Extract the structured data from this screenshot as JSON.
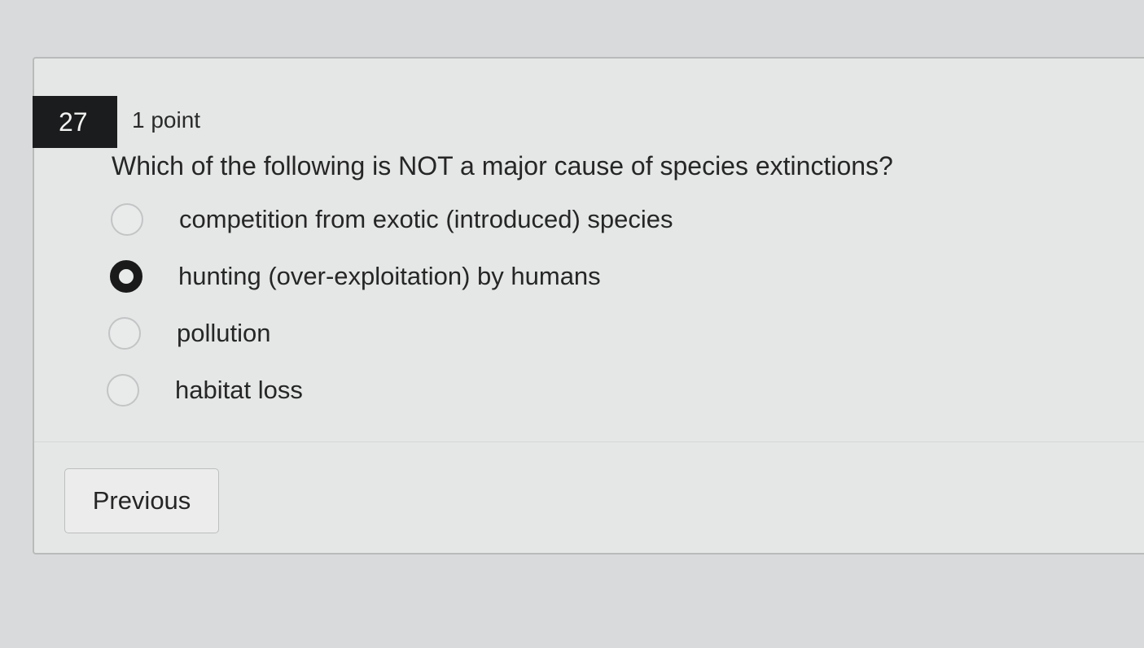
{
  "question": {
    "number": "27",
    "points": "1 point",
    "text": "Which of the following is NOT a major cause of species extinctions?",
    "selected_option": 1,
    "options": [
      {
        "label": "competition from exotic (introduced) species",
        "checked": false
      },
      {
        "label": "hunting (over-exploitation) by humans",
        "checked": true
      },
      {
        "label": "pollution",
        "checked": false
      },
      {
        "label": "habitat loss",
        "checked": false
      }
    ]
  },
  "navigation": {
    "previous_label": "Previous"
  },
  "colors": {
    "badge_background": "#1b1c1d",
    "page_background": "#d9dadb",
    "card_background": "#e5e6e6"
  }
}
